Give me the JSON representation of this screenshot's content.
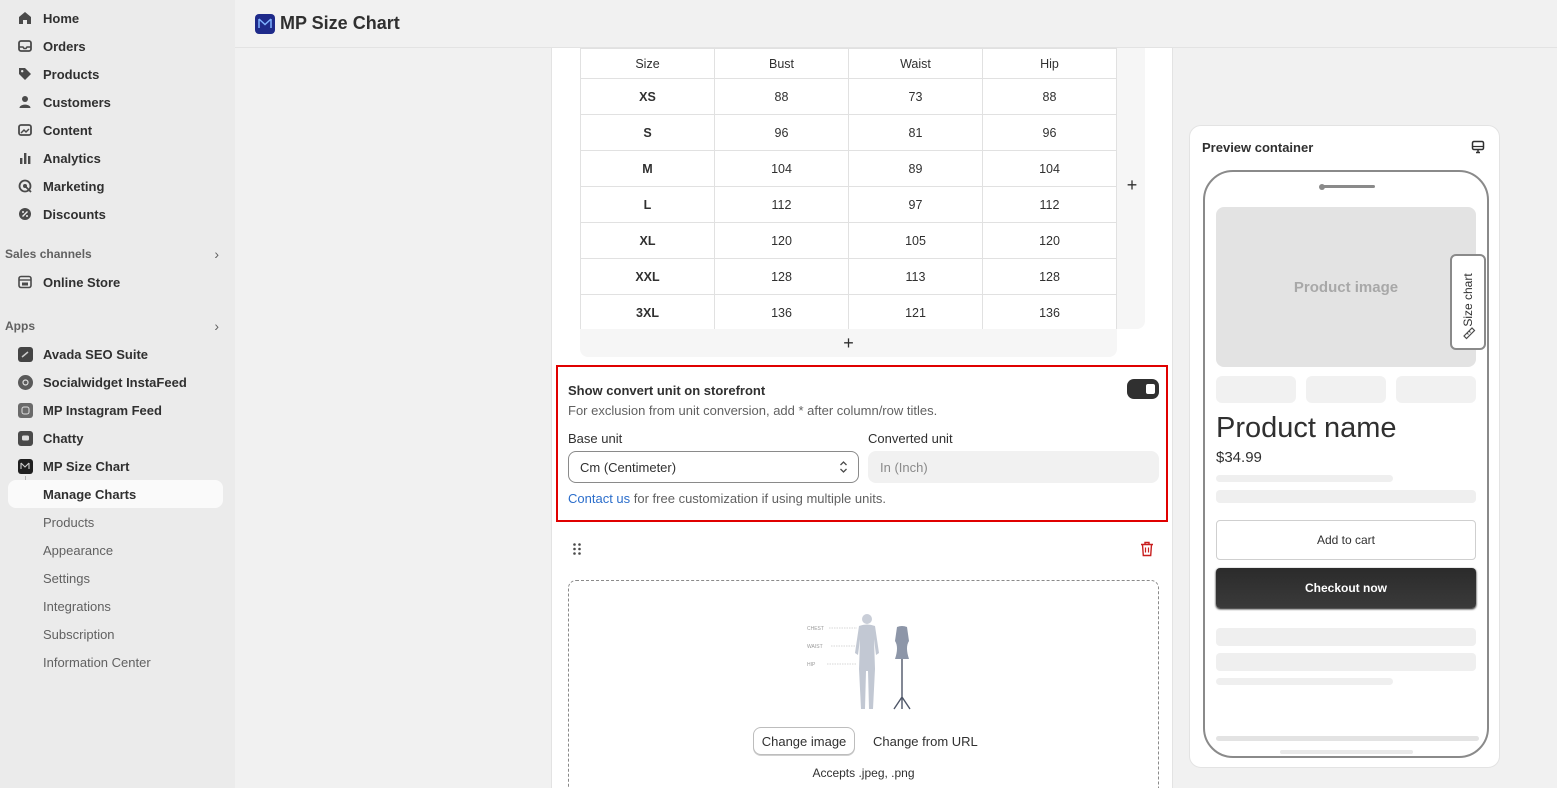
{
  "header": {
    "title": "MP Size Chart"
  },
  "sidebar": {
    "main_items": [
      {
        "label": "Home",
        "icon": "home-icon"
      },
      {
        "label": "Orders",
        "icon": "inbox-icon"
      },
      {
        "label": "Products",
        "icon": "tag-icon"
      },
      {
        "label": "Customers",
        "icon": "person-icon"
      },
      {
        "label": "Content",
        "icon": "image-icon"
      },
      {
        "label": "Analytics",
        "icon": "bar-chart-icon"
      },
      {
        "label": "Marketing",
        "icon": "target-icon"
      },
      {
        "label": "Discounts",
        "icon": "discount-icon"
      }
    ],
    "sales_channels": {
      "label": "Sales channels",
      "items": [
        {
          "label": "Online Store"
        }
      ]
    },
    "apps": {
      "label": "Apps",
      "items": [
        {
          "label": "Avada SEO Suite"
        },
        {
          "label": "Socialwidget InstaFeed"
        },
        {
          "label": "MP Instagram Feed"
        },
        {
          "label": "Chatty"
        },
        {
          "label": "MP Size Chart"
        }
      ],
      "sub_items": [
        {
          "label": "Manage Charts"
        },
        {
          "label": "Products"
        },
        {
          "label": "Appearance"
        },
        {
          "label": "Settings"
        },
        {
          "label": "Integrations"
        },
        {
          "label": "Subscription"
        },
        {
          "label": "Information Center"
        }
      ]
    }
  },
  "size_table": {
    "headers": [
      "Size",
      "Bust",
      "Waist",
      "Hip"
    ],
    "rows": [
      [
        "XS",
        "88",
        "73",
        "88"
      ],
      [
        "S",
        "96",
        "81",
        "96"
      ],
      [
        "M",
        "104",
        "89",
        "104"
      ],
      [
        "L",
        "112",
        "97",
        "112"
      ],
      [
        "XL",
        "120",
        "105",
        "120"
      ],
      [
        "XXL",
        "128",
        "113",
        "128"
      ],
      [
        "3XL",
        "136",
        "121",
        "136"
      ]
    ],
    "add_symbol": "+"
  },
  "convert": {
    "title": "Show convert unit on storefront",
    "subtitle": "For exclusion from unit conversion, add * after column/row titles.",
    "enabled": true,
    "base_label": "Base unit",
    "base_value": "Cm (Centimeter)",
    "converted_label": "Converted unit",
    "converted_value": "In (Inch)",
    "foot_link": "Contact us",
    "foot_text": " for free customization if using multiple units."
  },
  "image_block": {
    "change_image": "Change image",
    "change_url": "Change from URL",
    "accepts": "Accepts .jpeg, .png",
    "figure_labels": [
      "CHEST",
      "WAIST",
      "HIP"
    ]
  },
  "preview": {
    "title": "Preview container",
    "product_image": "Product image",
    "size_chart_tab": "Size chart",
    "product_name": "Product name",
    "price": "$34.99",
    "add_to_cart": "Add to cart",
    "checkout": "Checkout now"
  },
  "colors": {
    "highlight": "#e00000",
    "link": "#2c6ecb",
    "toggle": "#303030"
  }
}
